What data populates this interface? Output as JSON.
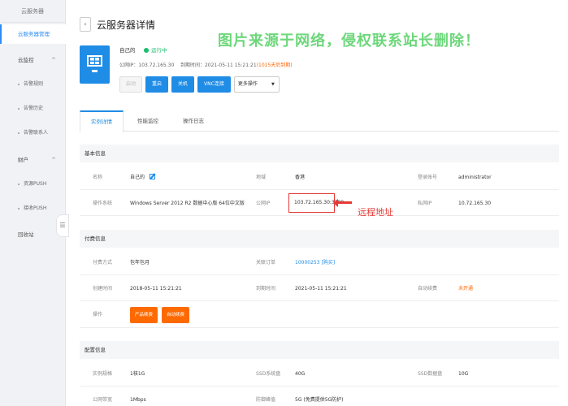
{
  "sidebar": {
    "top_title": "云服务器",
    "items": [
      {
        "label": "云服务器管理"
      },
      {
        "label": "云监控"
      },
      {
        "label": "告警规则"
      },
      {
        "label": "告警历史"
      },
      {
        "label": "告警联系人"
      },
      {
        "label": "财户"
      },
      {
        "label": "资源PUSH"
      },
      {
        "label": "接收PUSH"
      },
      {
        "label": "回收站"
      }
    ],
    "collapse_glyph": "☰"
  },
  "header": {
    "back_glyph": "‹",
    "title": "云服务器详情",
    "watermark": "图片来源于网络，侵权联系站长删除！"
  },
  "server": {
    "name": "自己的",
    "status": "运行中",
    "public_ip_label": "公网IP：",
    "public_ip": "103.72.165.30",
    "expire_label": "到期时间：",
    "expire_time": "2021-05-11 15:21:21",
    "expire_note": "(1015天后到期)",
    "actions": [
      "启动",
      "重启",
      "关机",
      "VNC连接"
    ],
    "more_select": "更多操作",
    "more_caret": "▼"
  },
  "tabs": [
    "实例详情",
    "性能监控",
    "操作日志"
  ],
  "basic": {
    "title": "基本信息",
    "name_label": "名称",
    "name_value": "自己的",
    "region_label": "地域",
    "region_value": "香港",
    "account_label": "登录账号",
    "account_value": "administrator",
    "os_label": "操作系统",
    "os_value": "Windows Server 2012 R2 数据中心版 64位中文版",
    "public_ip_label": "公网IP",
    "public_ip_value": "103.72.165.30:3389",
    "private_ip_label": "私网IP",
    "private_ip_value": "10.72.165.30",
    "annotation": "远程地址"
  },
  "billing": {
    "title": "付费信息",
    "pay_label": "付费方式",
    "pay_value": "包年包月",
    "order_label": "关联订单",
    "order_value": "10000253 [购买]",
    "create_label": "创建时间",
    "create_value": "2018-05-11 15:21:21",
    "expire_label": "到期时间",
    "expire_value": "2021-05-11 15:21:21",
    "auto_label": "自动续费",
    "auto_value": "未开通",
    "ops_label": "操作",
    "btn_renew": "产品续费",
    "btn_auto": "自动续费"
  },
  "config": {
    "title": "配置信息",
    "spec_label": "实例规格",
    "spec_value": "1核1G",
    "ssd_label": "SSD系统盘",
    "ssd_value": "40G",
    "ssd2_label": "SSD数据盘",
    "ssd2_value": "10G",
    "bw_label": "公网带宽",
    "bw_value": "1Mbps",
    "defense_label": "防御峰值",
    "defense_value": "5G (免费提供5G防护)"
  },
  "colors": {
    "accent": "#1f8ce6",
    "success": "#19be6b",
    "warning": "#ff6a00",
    "annotation": "#e53935",
    "watermark": "#5ed36d"
  }
}
